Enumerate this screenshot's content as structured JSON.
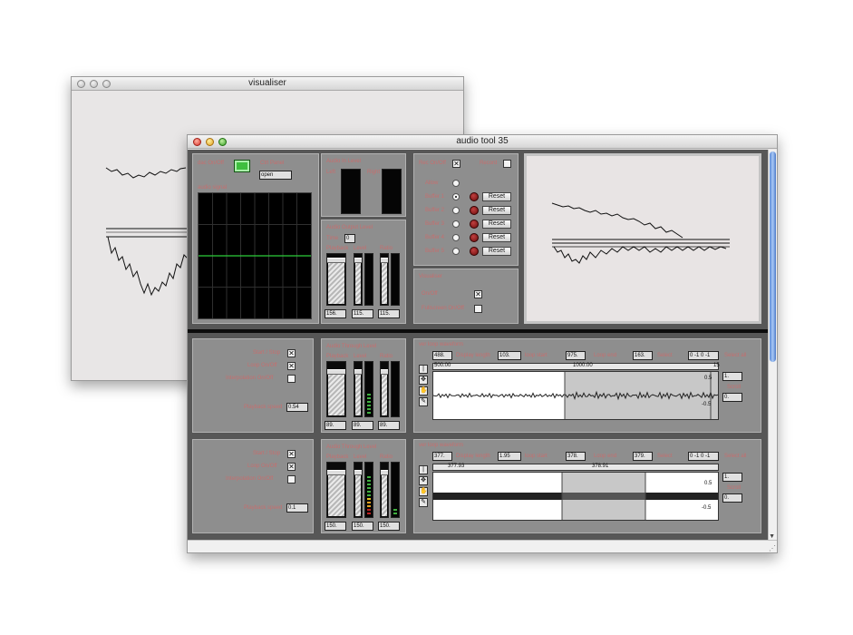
{
  "visualiser_window": {
    "title": "visualiser"
  },
  "main_window": {
    "title": "audio tool 35"
  },
  "dac": {
    "on_off_label": "dac On/Off",
    "ctl_label": "Ctrl Panel",
    "ctl_value": "open",
    "signal_label": "audio signal"
  },
  "audio_input": {
    "title": "Audio In Level",
    "left": "Left",
    "right": "Right"
  },
  "output_level": {
    "title": "Audio Output Level",
    "time_label": "Time",
    "time_value": "0",
    "col_labels": [
      "Playback",
      "Level",
      "Ratio"
    ],
    "values": [
      "156.",
      "115.",
      "115."
    ]
  },
  "buffer": {
    "record_label": "Rec On/Off",
    "record_checked": "✕",
    "rec_toggle_label": "Record",
    "none_label": "Allow",
    "rows": [
      "Buffer 1",
      "Buffer 2",
      "Buffer 3",
      "Buffer 4",
      "Buffer 5"
    ],
    "reset_label": "Reset",
    "selected_index": 0
  },
  "visualiser_panel": {
    "title": "Visualiser",
    "on_off_label": "On/Off",
    "fullscreen_label": "Fullscreen On/Off",
    "on_off_checked": "✕"
  },
  "channels": [
    {
      "start_stop": "Start / Stop",
      "loop": "Loop On/Off",
      "interp": "Interpolation On/Off",
      "speed_label": "Playback speed",
      "speed_value": "0.54",
      "start_checked": "✕",
      "loop_checked": "✕",
      "thru_title": "Audio Through Level",
      "thru_cols": [
        "Playback",
        "Level",
        "Ratio"
      ],
      "thru_values": [
        "89.",
        "89.",
        "89."
      ],
      "loop_title": "ver loop waveform",
      "loop_start_label": "loop start",
      "loop_start": "488.",
      "display_length_label": "Display length",
      "display_length": "103.",
      "display_start": "975.",
      "loop_end_label": "Loop end",
      "loop_end": "163.",
      "select_label": "Select",
      "select_value": "0 -1 0 -1",
      "time_ticks": [
        "500.00",
        "1000.00",
        "15"
      ],
      "y_ticks": [
        "0.5",
        "-0.5"
      ],
      "side_label_1": "Select all",
      "side_value_1": "1.",
      "side_label_2": "Scroll",
      "side_value_2": "0."
    },
    {
      "start_stop": "Start / Stop",
      "loop": "Loop On/Off",
      "interp": "Interpolation On/Off",
      "speed_label": "Playback speed",
      "speed_value": "0.1",
      "start_checked": "✕",
      "loop_checked": "✕",
      "thru_title": "Audio Through Level",
      "thru_cols": [
        "Playback",
        "Level",
        "Ratio"
      ],
      "thru_values": [
        "150.",
        "150.",
        "150."
      ],
      "loop_title": "ver loop waveform",
      "loop_start_label": "loop start",
      "loop_start": "377.",
      "display_length_label": "Display length",
      "display_length": "1.95",
      "display_start": "378.",
      "loop_end_label": "Loop end",
      "loop_end": "379.",
      "select_label": "Select",
      "select_value": "0 -1 0 -1",
      "time_ticks": [
        "377.93",
        "378.91"
      ],
      "y_ticks": [
        "0.5",
        "-0.5"
      ],
      "side_label_1": "Select all",
      "side_value_1": "1.",
      "side_label_2": "Scroll",
      "side_value_2": "0."
    }
  ],
  "colors": {
    "label": "#c56f6f",
    "patcher": "#575757",
    "panel": "#8e8e8e",
    "scope_line": "#2ecc3a"
  }
}
